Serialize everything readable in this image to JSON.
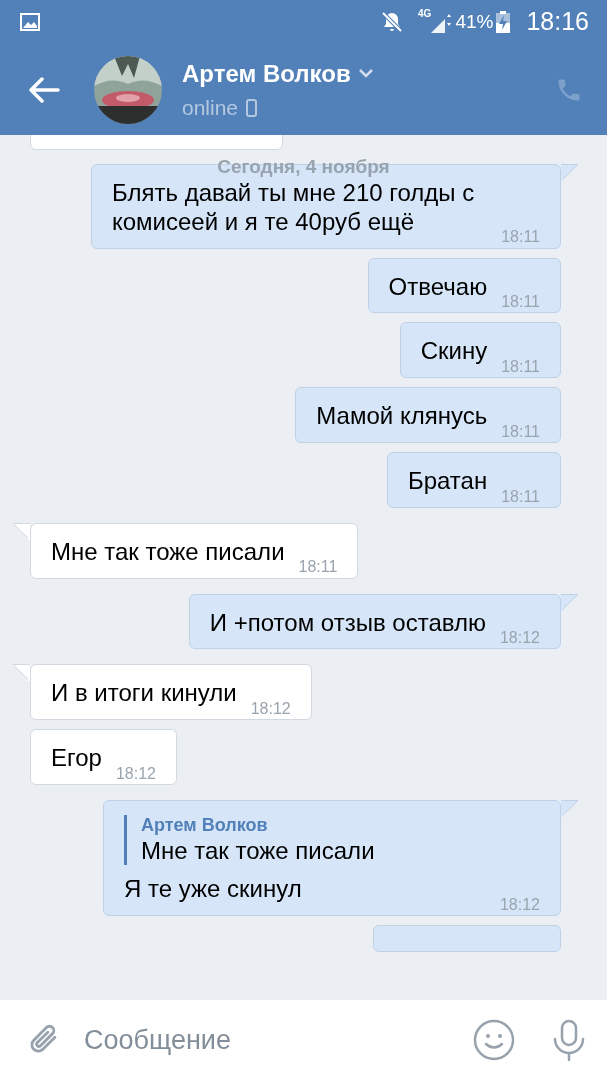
{
  "status_bar": {
    "network": "4G",
    "battery": "41%",
    "time": "18:16"
  },
  "header": {
    "name": "Артем Волков",
    "status": "online"
  },
  "date_label": "Сегодня, 4 ноября",
  "messages": [
    {
      "kind": "clipped",
      "outgoing": false,
      "tail": false
    },
    {
      "kind": "text",
      "outgoing": true,
      "tail": true,
      "text": "Блять давай ты мне 210 голды с комисеей и я те 40руб ещё",
      "time": "18:11"
    },
    {
      "kind": "text",
      "outgoing": true,
      "tail": false,
      "text": "Отвечаю",
      "time": "18:11"
    },
    {
      "kind": "text",
      "outgoing": true,
      "tail": false,
      "text": "Скину",
      "time": "18:11"
    },
    {
      "kind": "text",
      "outgoing": true,
      "tail": false,
      "text": "Мамой клянусь",
      "time": "18:11"
    },
    {
      "kind": "text",
      "outgoing": true,
      "tail": false,
      "text": "Братан",
      "time": "18:11"
    },
    {
      "kind": "text",
      "outgoing": false,
      "tail": true,
      "text": "Мне так тоже писали",
      "time": "18:11"
    },
    {
      "kind": "text",
      "outgoing": true,
      "tail": true,
      "text": "И +потом отзыв оставлю",
      "time": "18:12"
    },
    {
      "kind": "text",
      "outgoing": false,
      "tail": true,
      "text": "И в итоги кинули",
      "time": "18:12"
    },
    {
      "kind": "text",
      "outgoing": false,
      "tail": false,
      "text": "Егор",
      "time": "18:12"
    },
    {
      "kind": "reply",
      "outgoing": true,
      "tail": true,
      "quote_author": "Артем Волков",
      "quote_text": "Мне так тоже писали",
      "text": "Я те уже скинул",
      "time": "18:12"
    },
    {
      "kind": "clipped",
      "outgoing": true,
      "tail": false
    }
  ],
  "input": {
    "placeholder": "Сообщение"
  }
}
